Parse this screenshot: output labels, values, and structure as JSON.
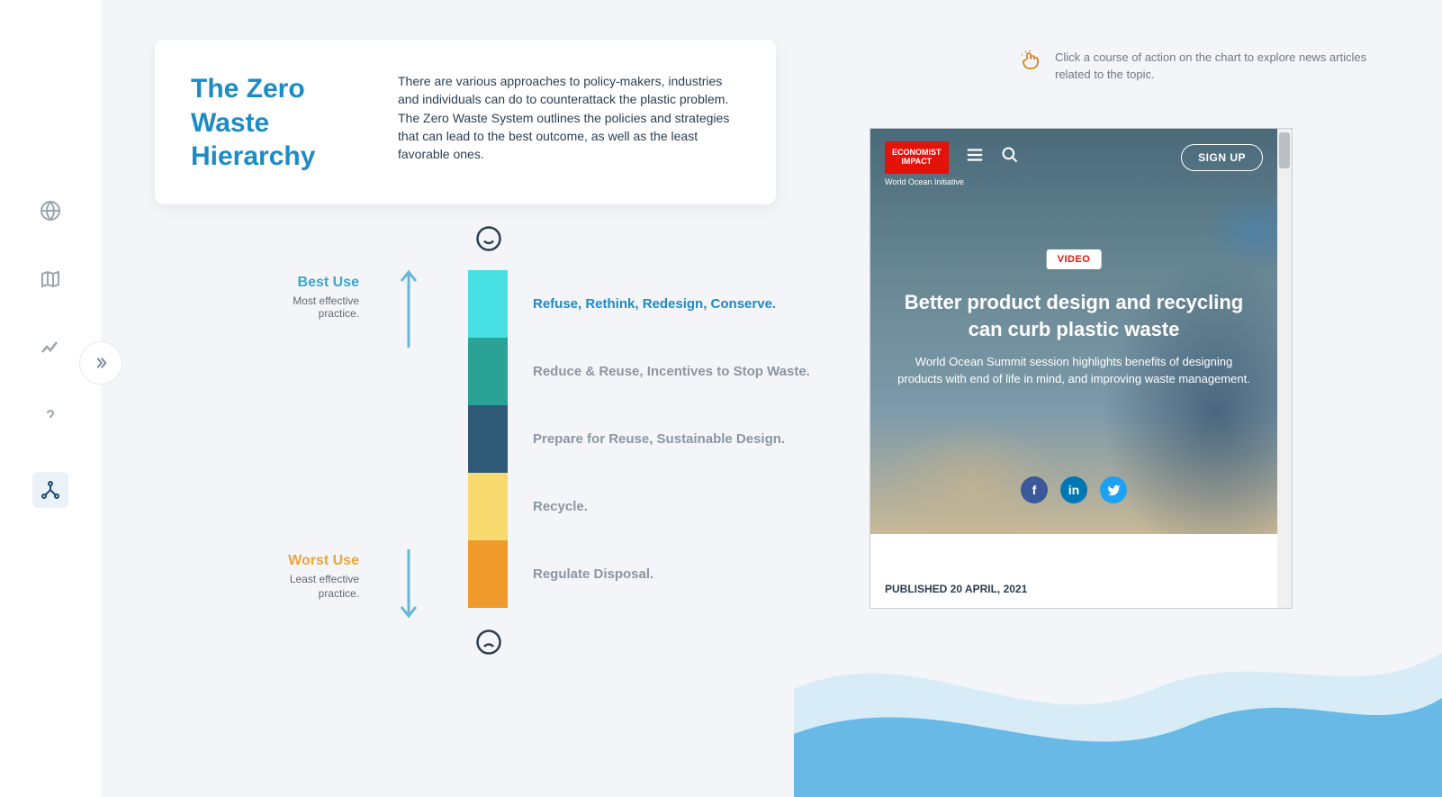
{
  "hero": {
    "title": "The Zero Waste Hierarchy",
    "description": "There are various approaches to policy-makers, industries and individuals can do to counterattack the plastic problem. The Zero Waste System outlines the policies and strategies that can lead to the best outcome, as well as the least favorable ones."
  },
  "chart": {
    "best": {
      "title": "Best Use",
      "subtitle": "Most effective practice."
    },
    "worst": {
      "title": "Worst Use",
      "subtitle": "Least effective practice."
    },
    "levels": [
      {
        "label": "Refuse, Rethink, Redesign, Conserve.",
        "color": "#46e0e3",
        "textColor": "#1e8bc3"
      },
      {
        "label": "Reduce & Reuse, Incentives to Stop Waste.",
        "color": "#2aa396",
        "textColor": "#8a97a3"
      },
      {
        "label": "Prepare for Reuse, Sustainable Design.",
        "color": "#2f5a78",
        "textColor": "#8a97a3"
      },
      {
        "label": "Recycle.",
        "color": "#f9da6f",
        "textColor": "#8a97a3"
      },
      {
        "label": "Regulate Disposal.",
        "color": "#ee9b2b",
        "textColor": "#8a97a3"
      }
    ]
  },
  "hint": "Click a course of action on the chart to explore news articles related to the topic.",
  "embed": {
    "brand_line1": "ECONOMIST",
    "brand_line2": "IMPACT",
    "subbrand": "World Ocean Initiative",
    "signup": "SIGN UP",
    "tag": "VIDEO",
    "headline": "Better product design and recycling can curb plastic waste",
    "sub": "World Ocean Summit session highlights benefits of designing products with end of life in mind, and improving waste management.",
    "published": "PUBLISHED 20 APRIL, 2021"
  }
}
